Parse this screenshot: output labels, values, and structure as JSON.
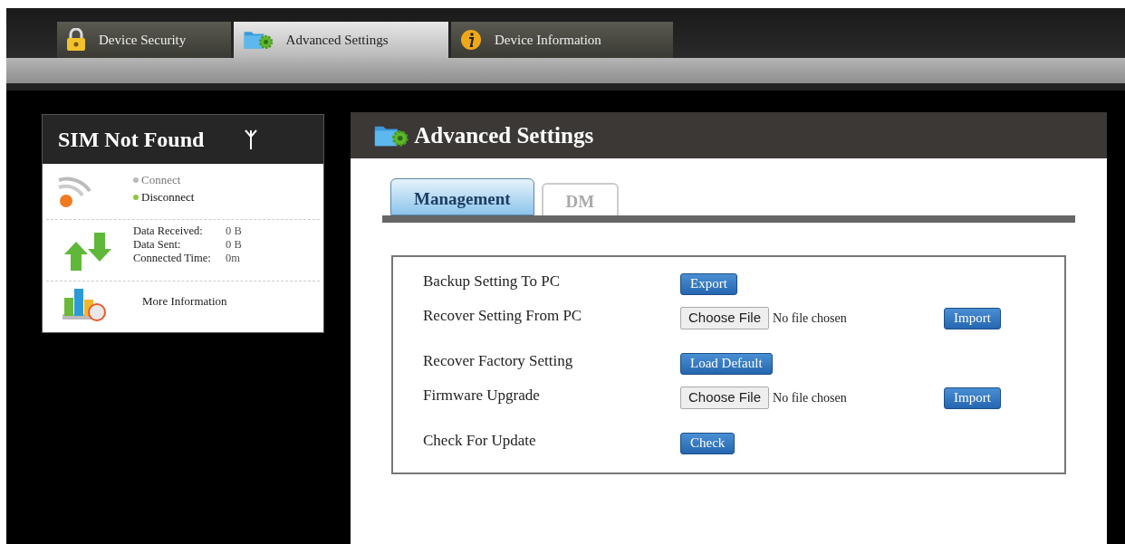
{
  "top_tabs": [
    {
      "label": "Device Security",
      "kind": "security",
      "selected": false
    },
    {
      "label": "Advanced Settings",
      "kind": "settings",
      "selected": true
    },
    {
      "label": "Device Information",
      "kind": "information",
      "selected": false
    }
  ],
  "sidebar": {
    "title": "SIM Not Found",
    "connection": [
      {
        "label": "Connect",
        "active": false
      },
      {
        "label": "Disconnect",
        "active": true
      }
    ],
    "stats": [
      {
        "label": "Data Received:",
        "value": "0 B"
      },
      {
        "label": "Data Sent:",
        "value": "0 B"
      },
      {
        "label": "Connected Time:",
        "value": "0m"
      }
    ],
    "more_link": "More Information"
  },
  "panel": {
    "title": "Advanced Settings",
    "tabs": [
      {
        "label": "Management",
        "selected": true
      },
      {
        "label": "DM",
        "selected": false
      }
    ],
    "groups": [
      [
        {
          "label": "Backup Setting To PC",
          "kind": "button",
          "button": "Export"
        },
        {
          "label": "Recover Setting From PC",
          "kind": "file",
          "file_button": "Choose File",
          "file_status": "No file chosen",
          "action": "Import"
        }
      ],
      [
        {
          "label": "Recover Factory Setting",
          "kind": "button",
          "button": "Load Default"
        },
        {
          "label": "Firmware Upgrade",
          "kind": "file",
          "file_button": "Choose File",
          "file_status": "No file chosen",
          "action": "Import"
        }
      ],
      [
        {
          "label": "Check For Update",
          "kind": "button",
          "button": "Check"
        }
      ]
    ]
  }
}
